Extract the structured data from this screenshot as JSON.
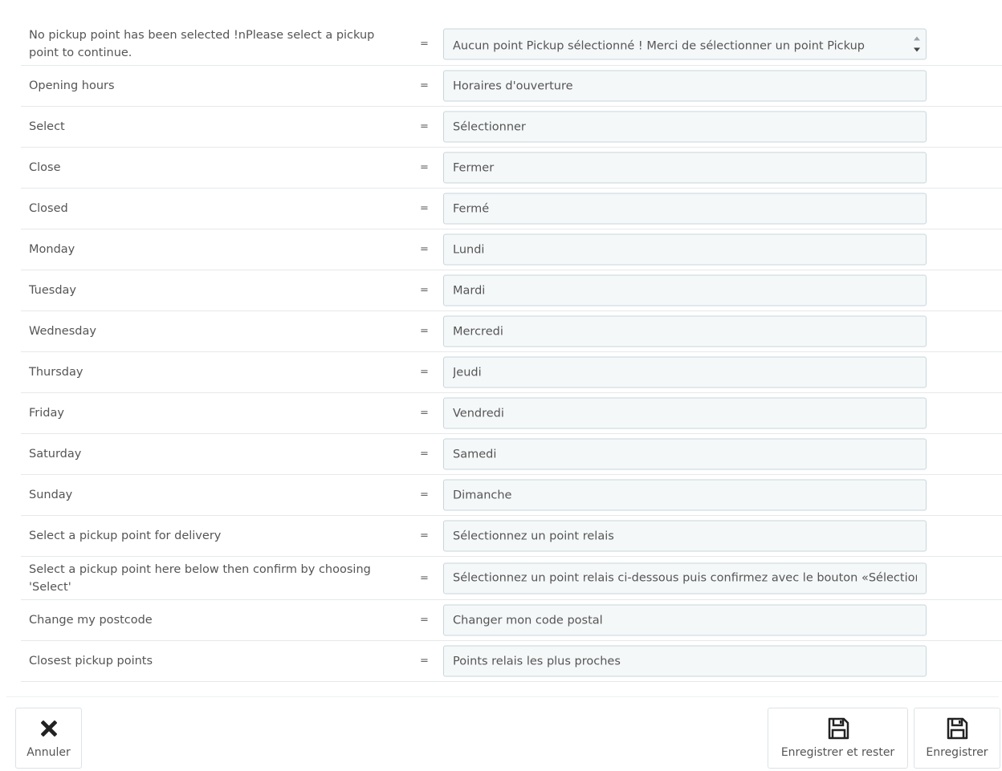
{
  "rows": [
    {
      "label": "No pickup point has been selected !nPlease select a pickup point to continue.",
      "value": "Aucun point Pickup sélectionné ! Merci de sélectionner un point Pickup"
    },
    {
      "label": "Opening hours",
      "value": "Horaires d'ouverture"
    },
    {
      "label": "Select",
      "value": "Sélectionner"
    },
    {
      "label": "Close",
      "value": "Fermer"
    },
    {
      "label": "Closed",
      "value": "Fermé"
    },
    {
      "label": "Monday",
      "value": "Lundi"
    },
    {
      "label": "Tuesday",
      "value": "Mardi"
    },
    {
      "label": "Wednesday",
      "value": "Mercredi"
    },
    {
      "label": "Thursday",
      "value": "Jeudi"
    },
    {
      "label": "Friday",
      "value": "Vendredi"
    },
    {
      "label": "Saturday",
      "value": "Samedi"
    },
    {
      "label": "Sunday",
      "value": "Dimanche"
    },
    {
      "label": "Select a pickup point for delivery",
      "value": "Sélectionnez un point relais"
    },
    {
      "label": "Select a pickup point here below then confirm by choosing 'Select'",
      "value": "Sélectionnez un point relais ci-dessous puis confirmez avec le bouton «Sélectionner»"
    },
    {
      "label": "Change my postcode",
      "value": "Changer mon code postal"
    },
    {
      "label": "Closest pickup points",
      "value": "Points relais les plus proches"
    }
  ],
  "equals_sign": "=",
  "footer": {
    "cancel_label": "Annuler",
    "save_stay_label": "Enregistrer et rester",
    "save_label": "Enregistrer"
  },
  "icons": {
    "cancel": "close-icon",
    "save_stay": "floppy-disk-icon",
    "save": "floppy-disk-icon"
  },
  "colors": {
    "field_background": "#f5f8f9",
    "field_border": "#c7d6db",
    "text": "#555555"
  }
}
